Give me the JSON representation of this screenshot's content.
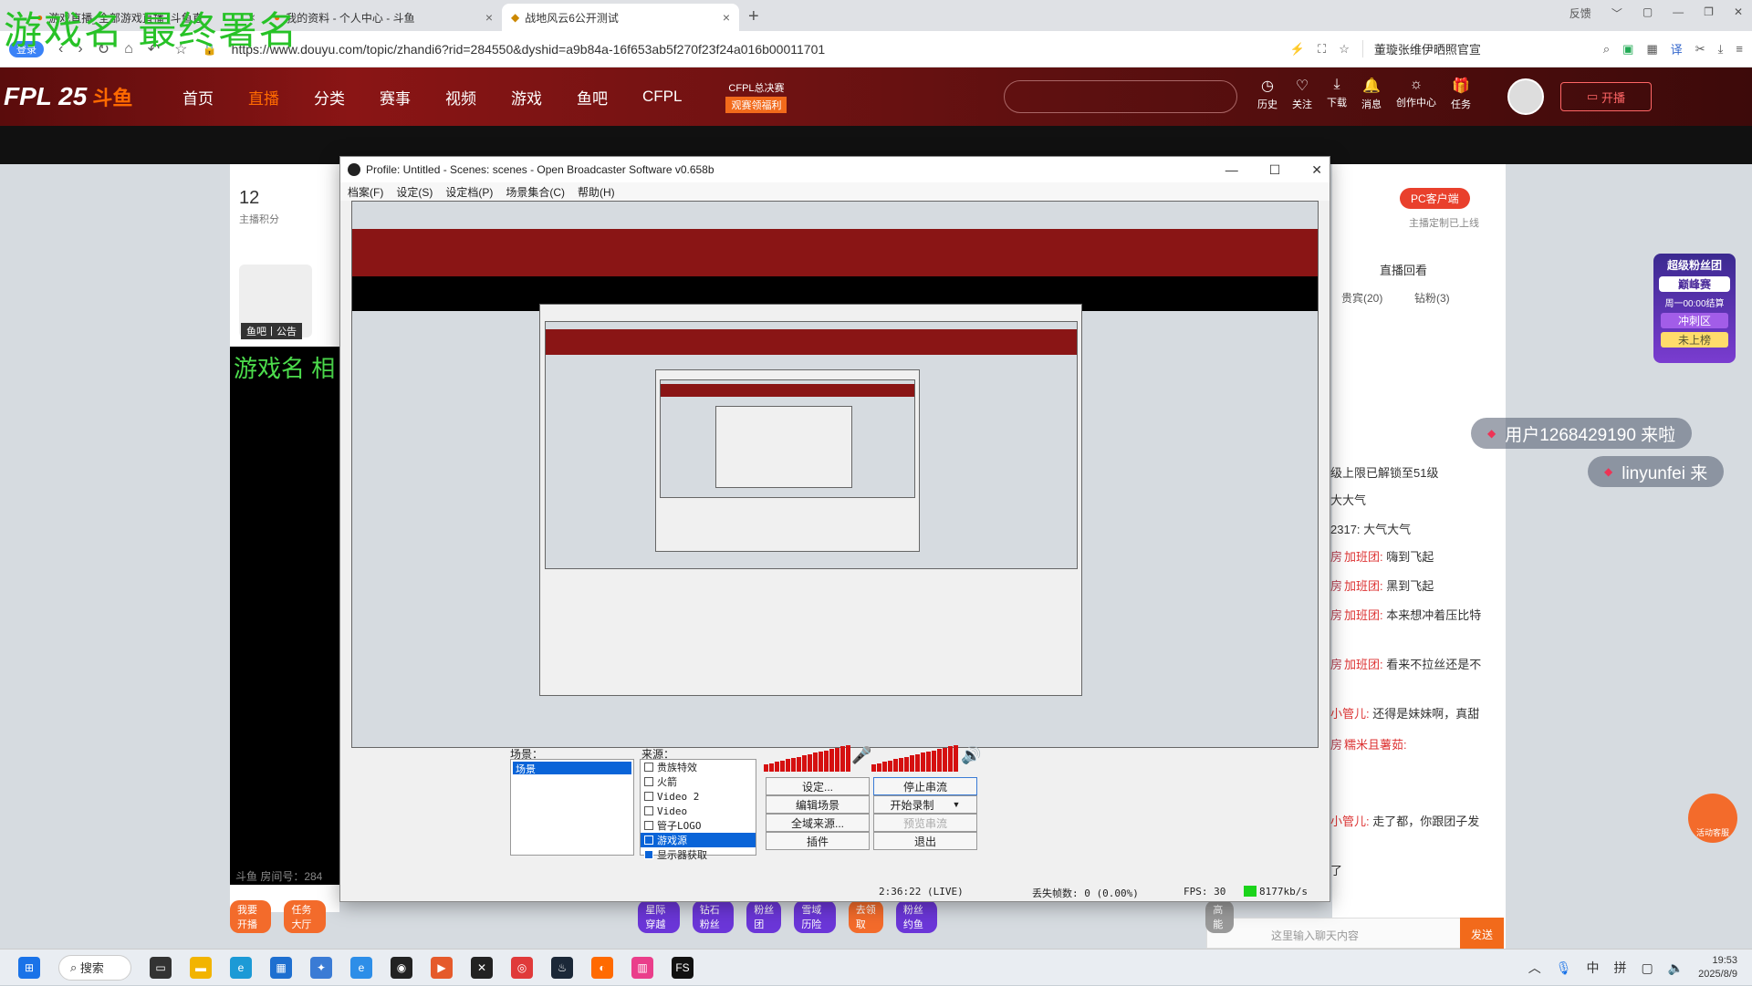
{
  "watermark": "游戏名 最终署名",
  "browser": {
    "tabs": [
      {
        "title": "游戏直播_全部游戏直播_斗鱼直"
      },
      {
        "title": "我的资料 - 个人中心 - 斗鱼"
      },
      {
        "title": "战地风云6公开测试"
      }
    ],
    "new_tab": "+",
    "window_controls": {
      "feedback": "反馈"
    },
    "login": "登录",
    "url": "https://www.douyu.com/topic/zhandi6?rid=284550&dyshid=a9b84a-16f653ab5f270f23f24a016b00011701",
    "search_text": "董璇张维伊晒照官宣"
  },
  "site": {
    "logo_text": "FPL 25",
    "logo_brand": "斗鱼",
    "nav": [
      "首页",
      "直播",
      "分类",
      "赛事",
      "视频",
      "游戏",
      "鱼吧",
      "CFPL"
    ],
    "nav_active": "直播",
    "cfpl_final": "CFPL总决赛",
    "cfpl_sub": "观赛领福利",
    "search_placeholder": "",
    "icons": [
      {
        "icon": "history-icon",
        "label": "历史"
      },
      {
        "icon": "heart-icon",
        "label": "关注"
      },
      {
        "icon": "download-icon",
        "label": "下载"
      },
      {
        "icon": "bell-icon",
        "label": "消息"
      },
      {
        "icon": "bulb-icon",
        "label": "创作中心"
      },
      {
        "icon": "gift-icon",
        "label": "任务"
      }
    ],
    "open_live": "开播"
  },
  "left": {
    "score": "12",
    "score_label": "主播积分",
    "fan_label": "鱼吧丨公告",
    "game_name": "游戏名 相",
    "room_no": "斗鱼 房间号：284"
  },
  "right": {
    "pc_client": "PC客户端",
    "pc_sub": "主播定制已上线",
    "replay": "直播回看",
    "tabs": [
      "贵宾(20)",
      "钻粉(3)"
    ],
    "rank": {
      "title": "超级粉丝团",
      "main": "巅峰赛",
      "sub": "周一00:00结算",
      "zone": "冲刺区",
      "status": "未上榜"
    },
    "join1": "用户1268429190  来啦",
    "join2": "linyunfei  来",
    "chat": [
      {
        "text": "级上限已解锁至51级"
      },
      {
        "text": "大大气"
      },
      {
        "text": "2317: 大气大气"
      },
      {
        "badge": "房",
        "fan": "加班团:",
        "text": "嗨到飞起"
      },
      {
        "badge": "房",
        "fan": "加班团:",
        "text": "黑到飞起"
      },
      {
        "badge": "房",
        "fan": "加班团:",
        "text": "本来想冲着压比特"
      },
      {
        "badge": "房",
        "fan": "加班团:",
        "text": "看来不拉丝还是不"
      },
      {
        "fan": "小管儿:",
        "text": "还得是妹妹啊，真甜"
      },
      {
        "badge": "房",
        "fan": "糯米且薯茹:",
        "text": ""
      },
      {
        "fan": "小管儿:",
        "text": "走了都，你跟团子发"
      },
      {
        "text": "了"
      }
    ],
    "chat_placeholder": "这里输入聊天内容",
    "send": "发送",
    "kefu": "活动客服",
    "bottom_btns": [
      "我要开播",
      "任务大厅"
    ],
    "gift_btns": [
      "星际穿越",
      "钻石粉丝",
      "粉丝团",
      "雪域历险",
      "去领取",
      "粉丝约鱼"
    ],
    "high": "高能"
  },
  "obs": {
    "title": "Profile: Untitled - Scenes: scenes - Open Broadcaster Software v0.658b",
    "menu": [
      "档案(F)",
      "设定(S)",
      "设定档(P)",
      "场景集合(C)",
      "帮助(H)"
    ],
    "scenes_label": "场景：",
    "scene_item": "场景",
    "sources_label": "来源：",
    "sources": [
      {
        "name": "贵族特效",
        "checked": false
      },
      {
        "name": "火箭",
        "checked": false
      },
      {
        "name": "Video 2",
        "checked": false
      },
      {
        "name": "Video",
        "checked": false
      },
      {
        "name": "管子LOGO",
        "checked": false
      },
      {
        "name": "游戏源",
        "checked": true
      },
      {
        "name": "显示器获取",
        "checked": true
      }
    ],
    "buttons": {
      "settings": "设定...",
      "stop_stream": "停止串流",
      "edit_scene": "编辑场景",
      "start_record": "开始录制",
      "global_sources": "全域来源...",
      "preview_stream": "预览串流",
      "plugins": "插件",
      "exit": "退出"
    },
    "status": {
      "time": "2:36:22 (LIVE)",
      "dropped": "丢失帧数: 0 (0.00%)",
      "fps": "FPS: 30",
      "bitrate": "8177kb/s"
    }
  },
  "taskbar": {
    "search": "搜索",
    "ime1": "中",
    "ime2": "拼",
    "time": "19:53",
    "date": "2025/8/9"
  }
}
